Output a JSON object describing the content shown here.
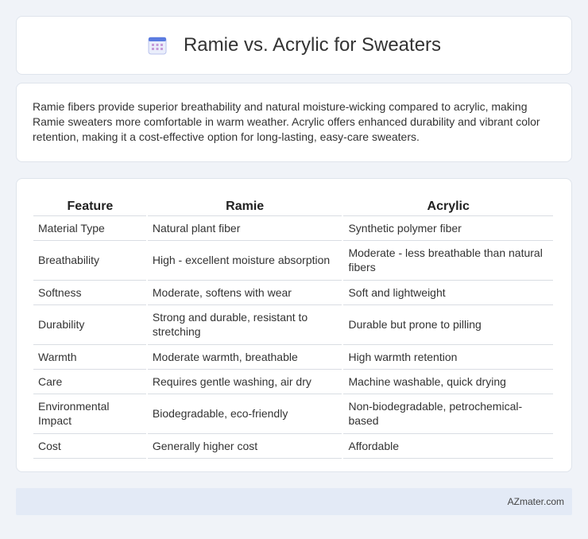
{
  "header": {
    "title": "Ramie vs. Acrylic for Sweaters",
    "icon": "calendar-grid-icon"
  },
  "intro": {
    "text": "Ramie fibers provide superior breathability and natural moisture-wicking compared to acrylic, making Ramie sweaters more comfortable in warm weather. Acrylic offers enhanced durability and vibrant color retention, making it a cost-effective option for long-lasting, easy-care sweaters."
  },
  "table": {
    "headers": [
      "Feature",
      "Ramie",
      "Acrylic"
    ],
    "rows": [
      [
        "Material Type",
        "Natural plant fiber",
        "Synthetic polymer fiber"
      ],
      [
        "Breathability",
        "High - excellent moisture absorption",
        "Moderate - less breathable than natural fibers"
      ],
      [
        "Softness",
        "Moderate, softens with wear",
        "Soft and lightweight"
      ],
      [
        "Durability",
        "Strong and durable, resistant to stretching",
        "Durable but prone to pilling"
      ],
      [
        "Warmth",
        "Moderate warmth, breathable",
        "High warmth retention"
      ],
      [
        "Care",
        "Requires gentle washing, air dry",
        "Machine washable, quick drying"
      ],
      [
        "Environmental Impact",
        "Biodegradable, eco-friendly",
        "Non-biodegradable, petrochemical-based"
      ],
      [
        "Cost",
        "Generally higher cost",
        "Affordable"
      ]
    ]
  },
  "footer": {
    "source": "AZmater.com"
  }
}
